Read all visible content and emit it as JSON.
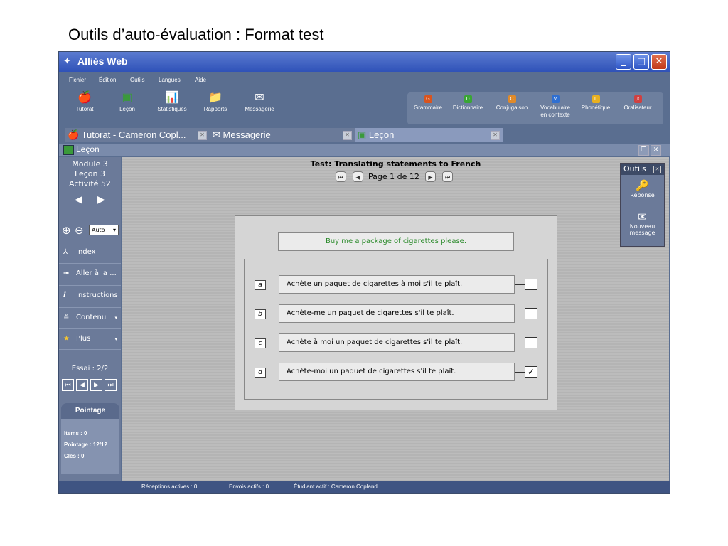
{
  "slide_title": "Outils d’auto-évaluation : Format test",
  "window": {
    "title": "Alliés Web",
    "min_glyph": "_",
    "max_glyph": "□",
    "close_glyph": "✕"
  },
  "menu": [
    "Fichier",
    "Édition",
    "Outils",
    "Langues",
    "Aide"
  ],
  "toolbar_left": [
    {
      "label": "Tutorat",
      "icon": "apple-icon",
      "glyph": "🍎"
    },
    {
      "label": "Leçon",
      "icon": "lesson-board-icon",
      "glyph": "▣"
    },
    {
      "label": "Statistiques",
      "icon": "stats-icon",
      "glyph": "📊"
    },
    {
      "label": "Rapports",
      "icon": "reports-folder-icon",
      "glyph": "📁"
    },
    {
      "label": "Messagerie",
      "icon": "mail-icon",
      "glyph": "✉"
    }
  ],
  "toolbar_right": [
    {
      "label": "Grammaire",
      "letter": "G",
      "color": "#d9541e"
    },
    {
      "label": "Dictionnaire",
      "letter": "D",
      "color": "#3aa635"
    },
    {
      "label": "Conjugaison",
      "letter": "C",
      "color": "#e08a2a"
    },
    {
      "label": "Vocabulaire",
      "label2": "en contexte",
      "letter": "V",
      "color": "#2f6fd1"
    },
    {
      "label": "Phonétique",
      "letter": "L",
      "color": "#e8b020"
    },
    {
      "label": "Oralisateur",
      "letter": "♫",
      "color": "#d04040"
    }
  ],
  "tabs": [
    {
      "label": "Tutorat - Cameron Copl...",
      "icon": "apple-icon",
      "glyph": "🍎"
    },
    {
      "label": "Messagerie",
      "icon": "mail-icon",
      "glyph": "✉"
    },
    {
      "label": "Leçon",
      "icon": "lesson-board-icon",
      "glyph": "▣"
    }
  ],
  "tab_close_glyph": "✕",
  "subbar": {
    "title": "Leçon",
    "restore_glyph": "❐",
    "close_glyph": "✕"
  },
  "left_panel": {
    "module": "Module 3",
    "lesson": "Leçon 3",
    "activity": "Activité 52",
    "prev_glyph": "◀",
    "next_glyph": "▶",
    "zoom_in_glyph": "⊕",
    "zoom_out_glyph": "⊖",
    "zoom_value": "Auto",
    "dropdown_glyph": "▾",
    "items": [
      {
        "label": "Index",
        "glyph": "⅄",
        "icon": "index-icon",
        "dropdown": false
      },
      {
        "label": "Aller à la ...",
        "glyph": "➟",
        "icon": "goto-arrow-icon",
        "dropdown": false
      },
      {
        "label": "Instructions",
        "glyph": "i",
        "icon": "info-icon",
        "dropdown": false
      },
      {
        "label": "Contenu",
        "glyph": "≗",
        "icon": "content-icon",
        "dropdown": true
      },
      {
        "label": "Plus",
        "glyph": "★",
        "icon": "star-icon",
        "dropdown": true
      }
    ],
    "attempt": "Essai : 2/2",
    "attempt_nav": [
      "⏮",
      "◀",
      "▶",
      "⏭"
    ],
    "score": {
      "header": "Pointage",
      "items": "Items : 0",
      "points": "Pointage : 12/12",
      "keys": "Clés : 0"
    }
  },
  "test": {
    "title": "Test: Translating statements to French",
    "page": "Page 1 de 12",
    "first_glyph": "⏮",
    "prev_glyph": "◀",
    "next_glyph": "▶",
    "last_glyph": "⏭",
    "prompt": "Buy me a package of cigarettes please.",
    "answers": [
      {
        "letter": "a",
        "text": "Achète un paquet de cigarettes à moi s'il te plaît.",
        "mark": ""
      },
      {
        "letter": "b",
        "text": "Achète-me un paquet de cigarettes s'il te plaît.",
        "mark": ""
      },
      {
        "letter": "c",
        "text": "Achète à moi un paquet de cigarettes s'il te plaît.",
        "mark": ""
      },
      {
        "letter": "d",
        "text": "Achète-moi un paquet de cigarettes s'il te plaît.",
        "mark": "✓"
      }
    ]
  },
  "outils": {
    "title": "Outils",
    "close_glyph": "✕",
    "items": [
      {
        "label": "Réponse",
        "glyph": "🔑",
        "icon": "key-icon"
      },
      {
        "label": "Nouveau",
        "label2": "message",
        "glyph": "✉",
        "icon": "new-message-icon"
      }
    ]
  },
  "status": {
    "receptions": "Réceptions actives : 0",
    "sends": "Envois actifs : 0",
    "student": "Étudiant actif : Cameron Copland"
  }
}
